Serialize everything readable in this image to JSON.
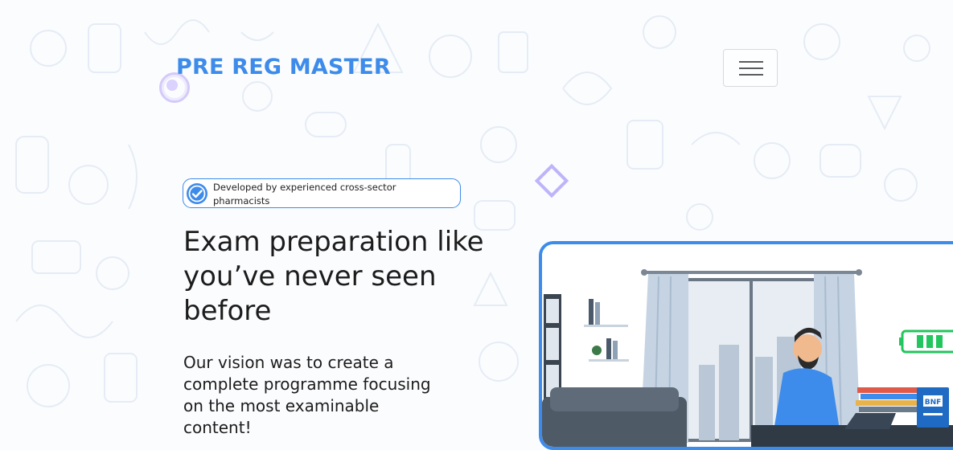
{
  "header": {
    "brand": "PRE REG MASTER",
    "menu_icon": "hamburger-menu-icon"
  },
  "hero": {
    "badge_icon": "check-circle-icon",
    "badge_text": "Developed by experienced cross-sector pharmacists",
    "headline": "Exam preparation like you’ve never seen before",
    "vision": "Our vision was to create a complete programme focusing on the most examinable content!"
  },
  "illustration": {
    "book_label": "BNF"
  },
  "colors": {
    "accent": "#3d8bea",
    "text": "#1c1c1c",
    "decor_purple": "#8c78f5"
  }
}
